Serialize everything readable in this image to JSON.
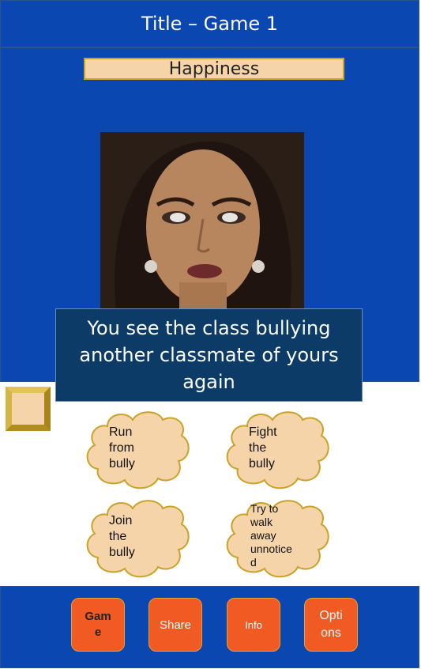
{
  "header": {
    "title": "Title – Game 1"
  },
  "mood": {
    "label": "Happiness"
  },
  "scenario": {
    "text": "You see the class bullying another classmate of yours again"
  },
  "choices": [
    {
      "label": "Run\nfrom\nbully"
    },
    {
      "label": "Fight\nthe\nbully"
    },
    {
      "label": "Join\nthe\nbully"
    },
    {
      "label": "Try to\nwalk\naway\nunnotice\nd"
    }
  ],
  "nav": [
    {
      "label": "Gam\ne"
    },
    {
      "label": "Share"
    },
    {
      "label": "Info"
    },
    {
      "label": "Opti\nons"
    }
  ],
  "colors": {
    "primary_blue": "#0a47b0",
    "prompt_navy": "#0b3b66",
    "peach": "#f6d4a9",
    "gold": "#c9a227",
    "nav_orange": "#f15a22"
  }
}
